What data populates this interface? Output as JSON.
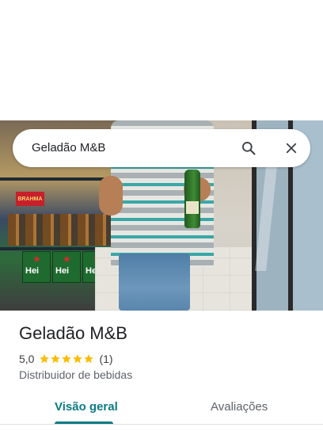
{
  "search": {
    "query": "Geladão M&B"
  },
  "photo": {
    "shelf_brand": "BRAHMA",
    "box_brand": "Hei"
  },
  "place": {
    "name": "Geladão M&B",
    "rating": "5,0",
    "stars": 5,
    "review_count": "(1)",
    "category": "Distribuidor de bebidas"
  },
  "tabs": [
    {
      "label": "Visão geral",
      "active": true
    },
    {
      "label": "Avaliações",
      "active": false
    }
  ],
  "colors": {
    "accent": "#0b7a83",
    "star": "#fbbc04"
  }
}
